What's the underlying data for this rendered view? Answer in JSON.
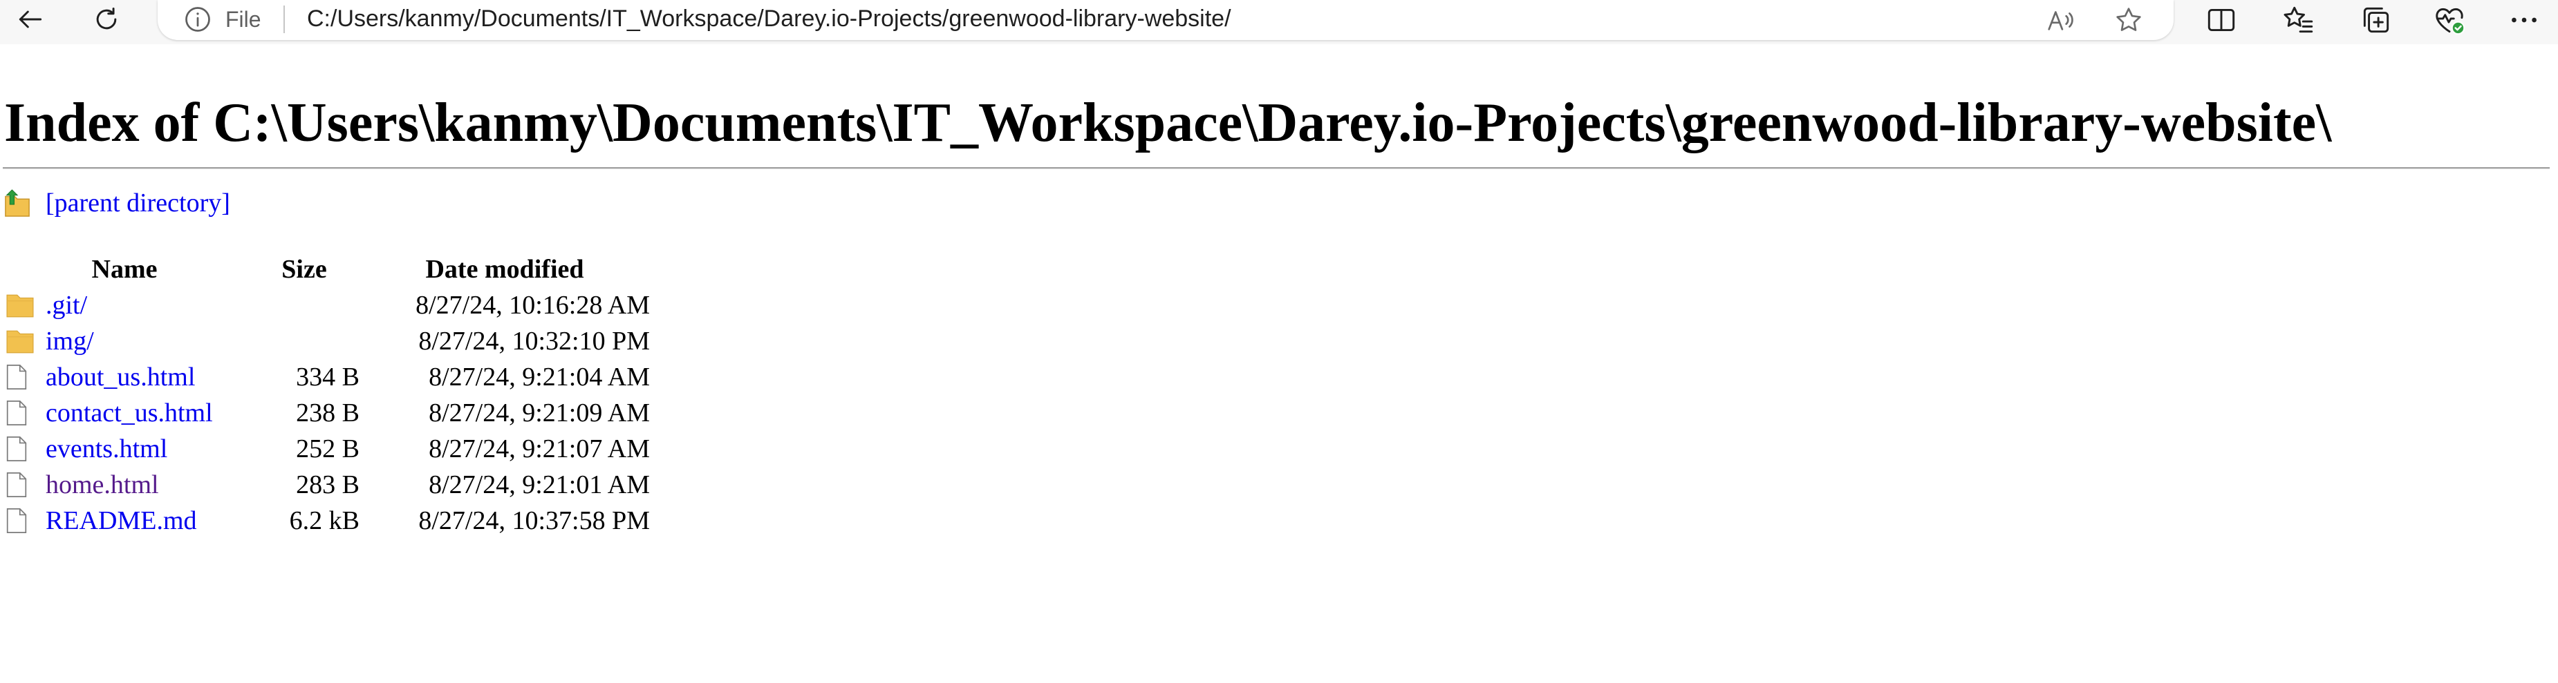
{
  "browser": {
    "scheme_label": "File",
    "url": "C:/Users/kanmy/Documents/IT_Workspace/Darey.io-Projects/greenwood-library-website/"
  },
  "page": {
    "title": "Index of C:\\Users\\kanmy\\Documents\\IT_Workspace\\Darey.io-Projects\\greenwood-library-website\\",
    "parent_link": "[parent directory]",
    "columns": {
      "name": "Name",
      "size": "Size",
      "date": "Date modified"
    },
    "entries": [
      {
        "name": ".git/",
        "size": "",
        "date": "8/27/24, 10:16:28 AM",
        "type": "folder",
        "visited": false
      },
      {
        "name": "img/",
        "size": "",
        "date": "8/27/24, 10:32:10 PM",
        "type": "folder",
        "visited": false
      },
      {
        "name": "about_us.html",
        "size": "334 B",
        "date": "8/27/24, 9:21:04 AM",
        "type": "file",
        "visited": false
      },
      {
        "name": "contact_us.html",
        "size": "238 B",
        "date": "8/27/24, 9:21:09 AM",
        "type": "file",
        "visited": false
      },
      {
        "name": "events.html",
        "size": "252 B",
        "date": "8/27/24, 9:21:07 AM",
        "type": "file",
        "visited": false
      },
      {
        "name": "home.html",
        "size": "283 B",
        "date": "8/27/24, 9:21:01 AM",
        "type": "file",
        "visited": true
      },
      {
        "name": "README.md",
        "size": "6.2 kB",
        "date": "8/27/24, 10:37:58 PM",
        "type": "file",
        "visited": false
      }
    ]
  },
  "colors": {
    "link": "#0000ee",
    "visited_link": "#551a8b",
    "folder": "#f5c542",
    "health_badge": "#2e9e3e"
  },
  "icons": {
    "back": "arrow-left-icon",
    "refresh": "refresh-icon",
    "info": "info-icon",
    "read_aloud": "read-aloud-icon",
    "favorite": "star-icon",
    "split_screen": "split-screen-icon",
    "favorites": "favorites-icon",
    "collections": "collections-icon",
    "browser_essentials": "heart-pulse-icon",
    "more": "more-icon",
    "folder": "folder-icon",
    "file": "file-icon",
    "parent": "folder-up-icon"
  }
}
